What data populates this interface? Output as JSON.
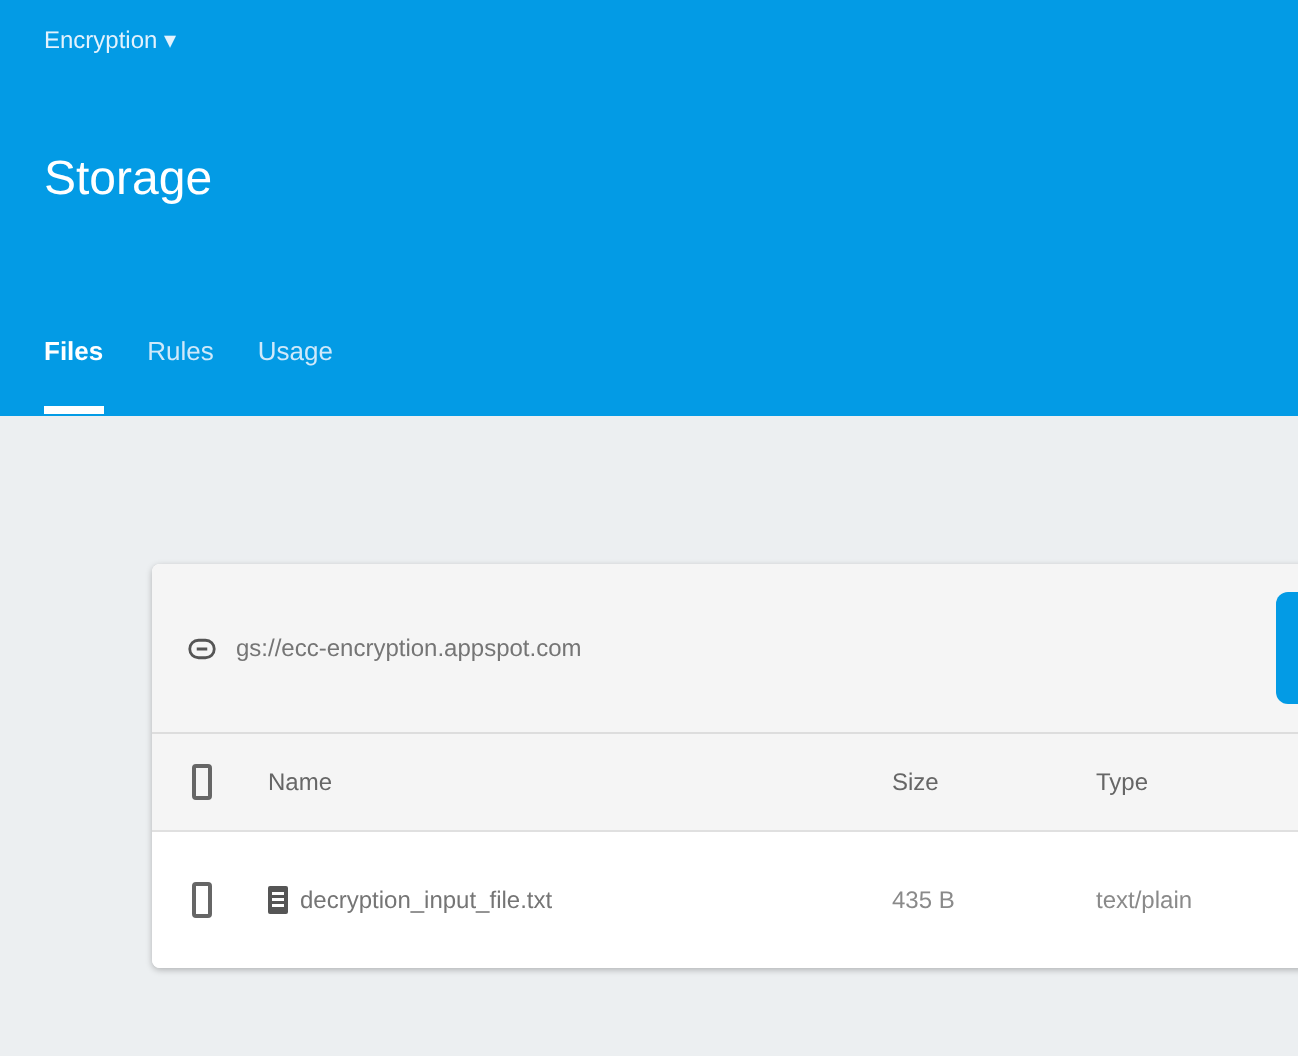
{
  "project": {
    "name": "Encryption",
    "caret": "▾"
  },
  "title": "Storage",
  "tabs": [
    {
      "label": "Files",
      "selected": true
    },
    {
      "label": "Rules",
      "selected": false
    },
    {
      "label": "Usage",
      "selected": false
    }
  ],
  "bucket": "gs://ecc-encryption.appspot.com",
  "table": {
    "columns": [
      "Name",
      "Size",
      "Type"
    ],
    "rows": [
      {
        "name": "decryption_input_file.txt",
        "size": "435 B",
        "type": "text/plain",
        "checked": false
      }
    ],
    "all_checked": false
  }
}
